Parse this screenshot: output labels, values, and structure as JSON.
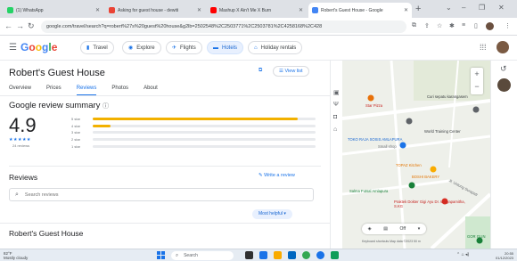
{
  "browser": {
    "tabs": [
      {
        "title": "(1) WhatsApp",
        "color": "#25d366"
      },
      {
        "title": "Asking for guest house - dewiti",
        "color": "#ea4335"
      },
      {
        "title": "Mashup X Ain't Me X Burn",
        "color": "#ff0000"
      },
      {
        "title": "Robert's Guest House - Google",
        "color": "#4285f4"
      }
    ],
    "new_tab_label": "+",
    "url": "google.com/travel/search?q=robert%27s%20guest%20house&g2lb=2502548%2C2503771%2C2503781%2C4258168%2C428",
    "window_controls": [
      "⌄",
      "–",
      "❐",
      "✕"
    ]
  },
  "header": {
    "logo": "Google",
    "logo_colors": [
      "#4285f4",
      "#ea4335",
      "#fbbc05",
      "#4285f4",
      "#34a853",
      "#ea4335"
    ],
    "nav_chips": [
      {
        "label": "Travel",
        "icon": "luggage-icon"
      },
      {
        "label": "Explore",
        "icon": "explore-icon"
      },
      {
        "label": "Flights",
        "icon": "flight-icon"
      },
      {
        "label": "Hotels",
        "icon": "hotel-icon"
      },
      {
        "label": "Holiday rentals",
        "icon": "home-icon"
      }
    ]
  },
  "hotel": {
    "name": "Robert's Guest House",
    "view_list_label": "View list",
    "tabs": [
      "Overview",
      "Prices",
      "Reviews",
      "Photos",
      "About"
    ],
    "active_tab": "Reviews",
    "summary_title": "Google review summary",
    "summary_info_icon": "ⓘ",
    "score": "4.9",
    "stars": "★★★★★",
    "review_count": "24 reviews",
    "distribution": [
      {
        "label": "5 star",
        "fraction": 0.92
      },
      {
        "label": "4 star",
        "fraction": 0.08
      },
      {
        "label": "3 star",
        "fraction": 0.0
      },
      {
        "label": "2 star",
        "fraction": 0.0
      },
      {
        "label": "1 star",
        "fraction": 0.0
      }
    ],
    "reviews_heading": "Reviews",
    "write_review_label": "Write a review",
    "search_placeholder": "Search reviews",
    "sort_label": "Most helpful ▾",
    "section_title_bottom": "Robert's Guest House"
  },
  "map": {
    "labels": [
      {
        "text": "Star Pizza",
        "color": "#c5221f"
      },
      {
        "text": "Curi sepatu karangasem",
        "color": "#3c4043"
      },
      {
        "text": "World Training Center",
        "color": "#3c4043"
      },
      {
        "text": "TOKO RAJA SOSIS AMLAPURA",
        "color": "#1967d2"
      },
      {
        "text": "Small shop",
        "color": "#70757a"
      },
      {
        "text": "TOPAZ Kitchen",
        "color": "#e37400"
      },
      {
        "text": "BOSHI BAKERY",
        "color": "#e37400"
      },
      {
        "text": "Salma Futsal Amlapura",
        "color": "#188038"
      },
      {
        "text": "Praktek Dokter Gigi Ayu Dr. Widyapamitha, S.KG",
        "color": "#c5221f"
      },
      {
        "text": "Jl. Untung Surapati",
        "color": "#5f6368"
      },
      {
        "text": "GOR GLIN",
        "color": "#188038"
      }
    ],
    "zoom_in": "+",
    "zoom_out": "−",
    "layer_toggle": "Off",
    "attribution": "Keyboard shortcuts   Map data ©2023   50 m"
  },
  "taskbar": {
    "weather_temp": "82°F",
    "weather_desc": "Mostly cloudy",
    "search_placeholder": "Search",
    "time": "20:55",
    "date": "01/12/2023"
  }
}
